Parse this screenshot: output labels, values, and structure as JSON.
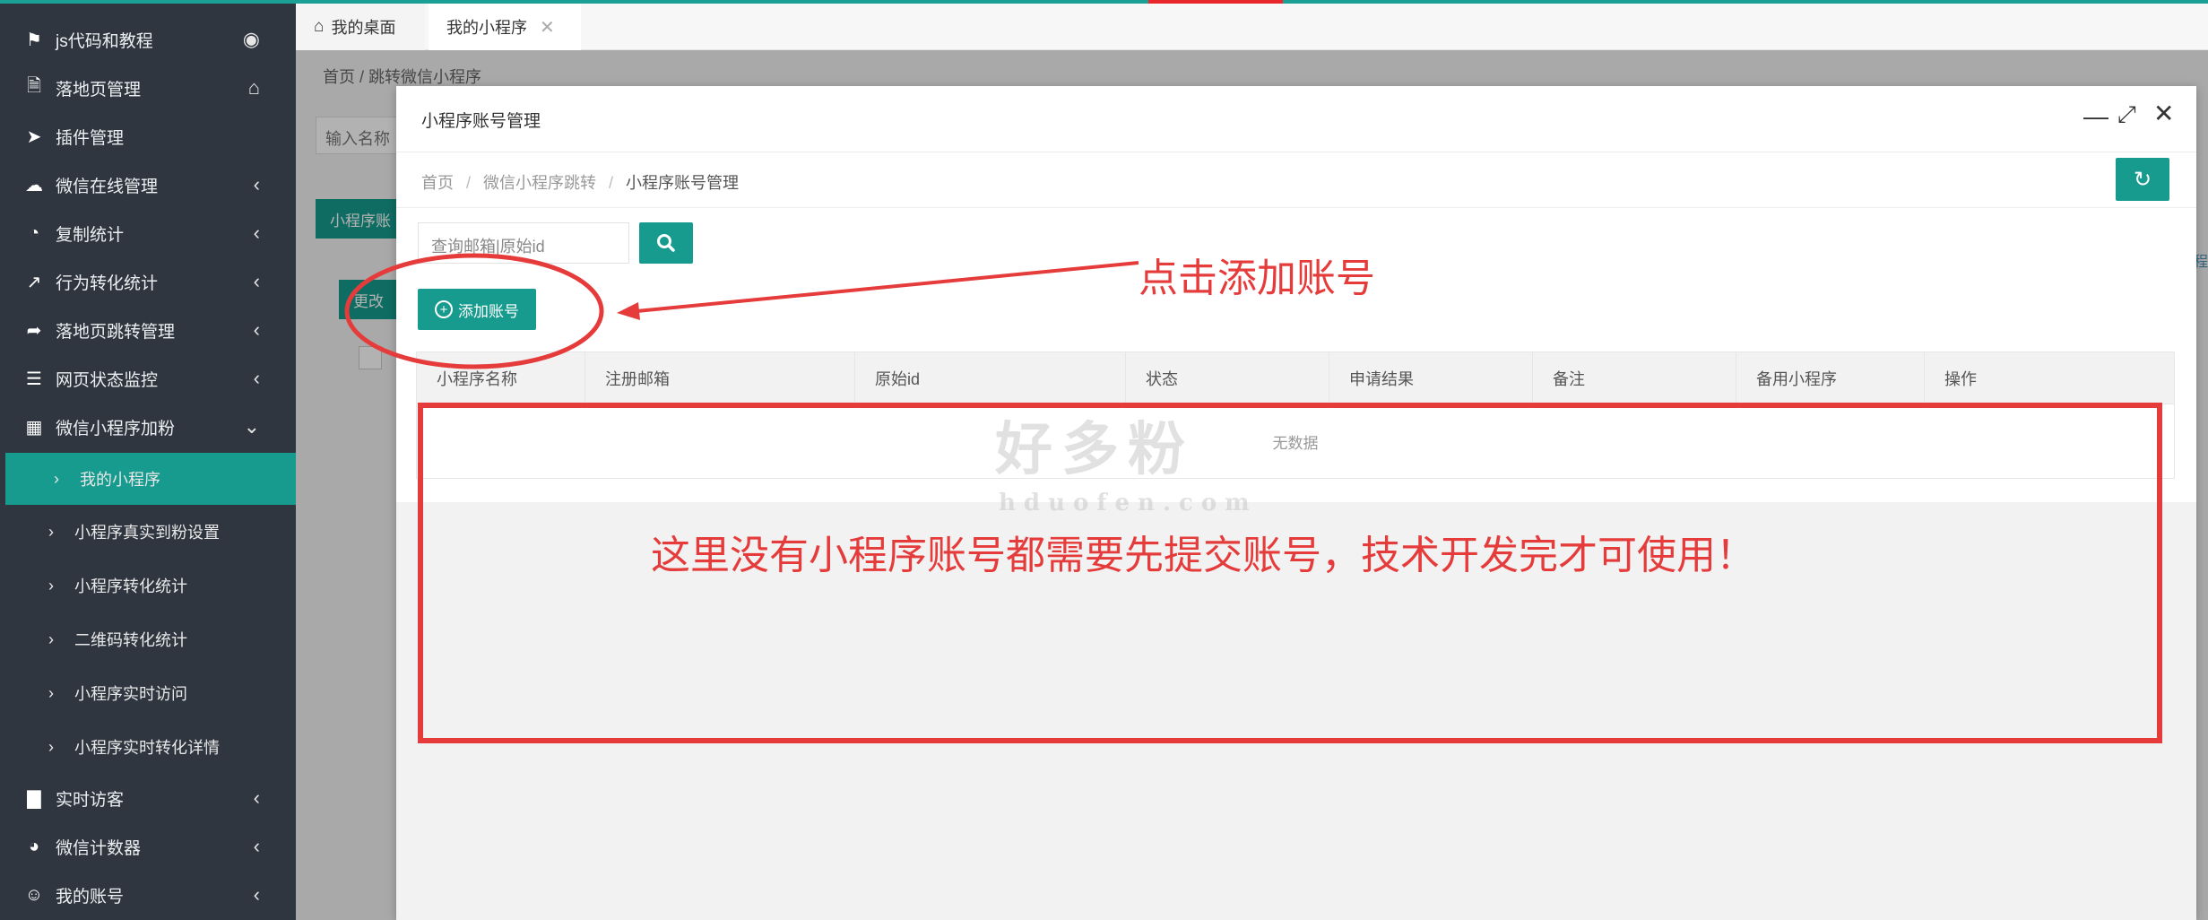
{
  "sidebar": {
    "items": [
      {
        "label": "js代码和教程",
        "icon": "bookmark-icon",
        "right_icon": "eye-icon"
      },
      {
        "label": "落地页管理",
        "icon": "document-chart-icon",
        "right_icon": "home-icon"
      },
      {
        "label": "插件管理",
        "icon": "paper-plane-icon",
        "right_icon": ""
      },
      {
        "label": "微信在线管理",
        "icon": "wechat-icon",
        "right_icon": "chevron-left-icon"
      },
      {
        "label": "复制统计",
        "icon": "pie-chart-icon",
        "right_icon": "chevron-left-icon"
      },
      {
        "label": "行为转化统计",
        "icon": "line-chart-icon",
        "right_icon": "chevron-left-icon"
      },
      {
        "label": "落地页跳转管理",
        "icon": "share-arrow-icon",
        "right_icon": "chevron-left-icon"
      },
      {
        "label": "网页状态监控",
        "icon": "list-icon",
        "right_icon": "chevron-left-icon"
      },
      {
        "label": "微信小程序加粉",
        "icon": "calendar-icon",
        "right_icon": "chevron-down-icon"
      }
    ],
    "subitems": [
      {
        "label": "我的小程序",
        "active": true
      },
      {
        "label": "小程序真实到粉设置",
        "active": false
      },
      {
        "label": "小程序转化统计",
        "active": false
      },
      {
        "label": "二维码转化统计",
        "active": false
      },
      {
        "label": "小程序实时访问",
        "active": false
      },
      {
        "label": "小程序实时转化详情",
        "active": false
      }
    ],
    "bottom_items": [
      {
        "label": "实时访客",
        "icon": "bar-chart-icon",
        "right_icon": "chevron-left-icon"
      },
      {
        "label": "微信计数器",
        "icon": "pie-chart-icon",
        "right_icon": "chevron-left-icon"
      },
      {
        "label": "我的账号",
        "icon": "user-icon",
        "right_icon": "chevron-left-icon"
      }
    ]
  },
  "tabs": [
    {
      "label": "我的桌面",
      "icon": "home-icon",
      "active": false
    },
    {
      "label": "我的小程序",
      "icon": "close-icon",
      "active": true
    }
  ],
  "background": {
    "breadcrumb": "首页   /   跳转微信小程序",
    "search_placeholder": "输入名称",
    "btn1": "小程序账",
    "btn2": "更改",
    "right_text": "程"
  },
  "modal": {
    "title": "小程序账号管理",
    "breadcrumb": [
      "首页",
      "微信小程序跳转",
      "小程序账号管理"
    ],
    "search_placeholder": "查询邮箱|原始id",
    "add_button": "添加账号",
    "table": {
      "columns": [
        "小程序名称",
        "注册邮箱",
        "原始id",
        "状态",
        "申请结果",
        "备注",
        "备用小程序",
        "操作"
      ],
      "empty_text": "无数据"
    }
  },
  "watermark": {
    "cn": "好多粉",
    "en": "hduofen.com"
  },
  "annotations": {
    "arrow_text": "点击添加账号",
    "box_text": "这里没有小程序账号都需要先提交账号，技术开发完才可使用！",
    "color": "#e53b3b"
  },
  "colors": {
    "accent": "#169b8e",
    "sidebar": "#2f3640",
    "annotation": "#e53b3b"
  }
}
